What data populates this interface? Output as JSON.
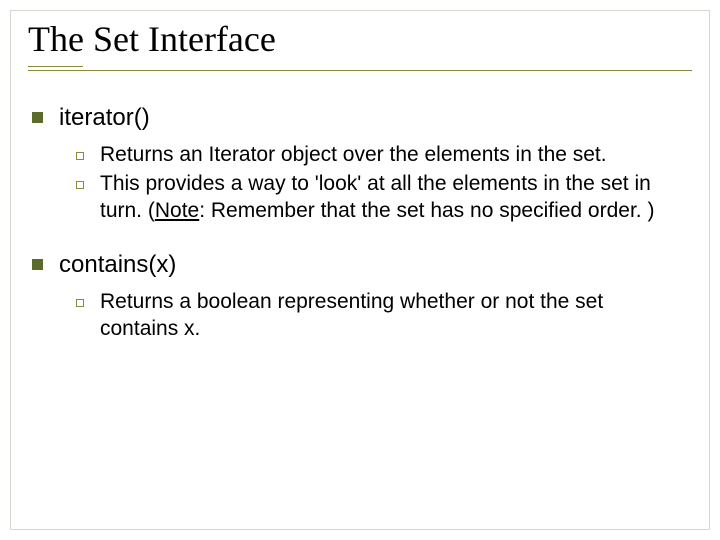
{
  "title": "The Set Interface",
  "items": [
    {
      "heading": "iterator()",
      "subs": [
        {
          "text": "Returns an Iterator object over the elements in the set."
        },
        {
          "text_pre": "This provides a way to 'look' at all the elements in the set in turn. (",
          "note_label": "Note",
          "text_post": ": Remember that the set has no specified order. )"
        }
      ]
    },
    {
      "heading": "contains(x)",
      "subs": [
        {
          "text": "Returns a boolean representing whether or not the set contains x."
        }
      ]
    }
  ]
}
